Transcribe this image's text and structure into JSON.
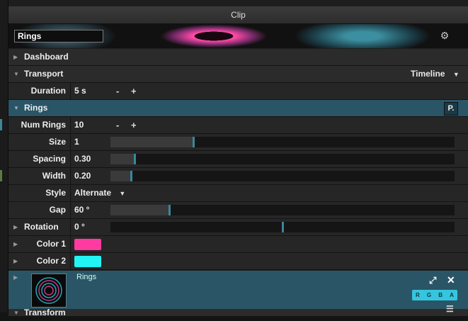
{
  "window": {
    "title": "Clip"
  },
  "clip": {
    "name": "Rings",
    "settings_icon": "gear-icon"
  },
  "sections": {
    "dashboard": "Dashboard",
    "transport": {
      "label": "Transport",
      "mode": "Timeline"
    },
    "rings": {
      "label": "Rings",
      "param_button": "P."
    },
    "transform": "Transform"
  },
  "transport_params": {
    "duration": {
      "label": "Duration",
      "value": "5 s"
    }
  },
  "stepper": {
    "minus": "-",
    "plus": "+"
  },
  "rings_params": {
    "num_rings": {
      "label": "Num Rings",
      "value": "10"
    },
    "size": {
      "label": "Size",
      "value": "1",
      "level": 0.24
    },
    "spacing": {
      "label": "Spacing",
      "value": "0.30",
      "level": 0.07
    },
    "width": {
      "label": "Width",
      "value": "0.20",
      "level": 0.06
    },
    "style": {
      "label": "Style",
      "value": "Alternate"
    },
    "gap": {
      "label": "Gap",
      "value": "60 °",
      "level": 0.17
    },
    "rotation": {
      "label": "Rotation",
      "value": "0 °",
      "level": 0.5
    },
    "color1": {
      "label": "Color 1",
      "color": "#ff3aa0"
    },
    "color2": {
      "label": "Color 2",
      "color": "#22f4f4"
    }
  },
  "effect": {
    "name": "Rings",
    "channels": [
      "R",
      "G",
      "B",
      "A"
    ],
    "expand_icon": "expand-icon",
    "close_icon": "close-icon"
  },
  "colors": {
    "accent": "#2a5566",
    "handle": "#3b8799",
    "rgba_badge": "#35c6df"
  }
}
